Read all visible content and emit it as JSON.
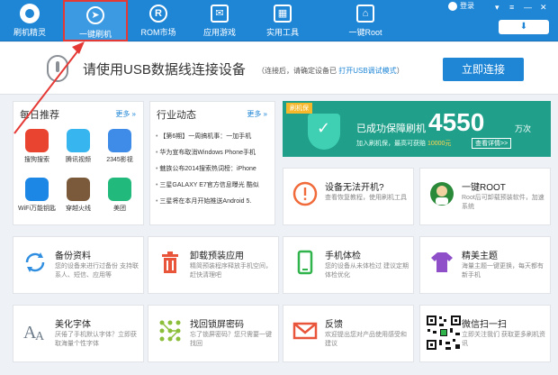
{
  "app": {
    "logo_label": "刷机精灵",
    "user_label": "登录"
  },
  "nav": {
    "tabs": [
      {
        "label": "一键刷机",
        "icon": "cursor-icon"
      },
      {
        "label": "ROM市场",
        "icon": "rom-icon"
      },
      {
        "label": "应用游戏",
        "icon": "mail-icon"
      },
      {
        "label": "实用工具",
        "icon": "tools-grid-icon"
      },
      {
        "label": "一键Root",
        "icon": "root-icon"
      }
    ]
  },
  "connect": {
    "main_text": "请使用USB数据线连接设备",
    "sub_text": "（连接后，请确定设备已 ",
    "sub_link": "打开USB调试模式",
    "sub_end": "）",
    "button_label": "立即连接"
  },
  "recommend": {
    "title": "每日推荐",
    "more": "更多",
    "apps": [
      {
        "label": "搜狗搜索",
        "color": "#e8442f"
      },
      {
        "label": "腾讯视频",
        "color": "#36b5ef"
      },
      {
        "label": "2345影视",
        "color": "#3e8be8"
      },
      {
        "label": "WiFi万能钥匙",
        "color": "#1d87e5"
      },
      {
        "label": "穿越火线",
        "color": "#7a5a3a"
      },
      {
        "label": "美团",
        "color": "#22b97c"
      }
    ]
  },
  "news": {
    "title": "行业动态",
    "more": "更多",
    "items": [
      "【第6期】一周搞机事：一加手机",
      "华为宣布取消Windows Phone手机",
      "魅族公布2014搜索热词榜：iPhone",
      "三星GALAXY E7官方信息曝光 酷似",
      "三星将在本月开始推送Android 5."
    ]
  },
  "banner": {
    "tag": "刷机保",
    "label": "已成功保障刷机",
    "count": "4550",
    "unit": "万次",
    "sub_a": "加入刷机保，最高可获赔 ",
    "sub_amount": "10000元",
    "link": "查看详情>>"
  },
  "features": [
    {
      "title": "设备无法开机?",
      "desc": "查看恢复教程，使用刷机工具",
      "icon": "alert-icon"
    },
    {
      "title": "一键ROOT",
      "desc": "Root后可卸载预装软件，加速系统",
      "icon": "root-avatar-icon"
    },
    {
      "title": "备份资料",
      "desc": "您的设备来进行过备份 支持联系人、短信、应用等",
      "icon": "sync-icon"
    },
    {
      "title": "卸载预装应用",
      "desc": "精简预装程序释放手机空间，赶快清理吧",
      "icon": "trash-icon"
    },
    {
      "title": "手机体检",
      "desc": "您的设备从未体检过 建议定期体检优化",
      "icon": "phone-check-icon"
    },
    {
      "title": "精美主题",
      "desc": "海量主题一键更换，每天都有新手机",
      "icon": "shirt-icon"
    },
    {
      "title": "美化字体",
      "desc": "厌倦了手机默认字体？立即获取海量个性字体",
      "icon": "font-icon"
    },
    {
      "title": "找回锁屏密码",
      "desc": "忘了锁屏密码？您只需要一键找回",
      "icon": "pattern-lock-icon"
    },
    {
      "title": "反馈",
      "desc": "欢迎提出您对产品使用感受和建议",
      "icon": "envelope-icon"
    },
    {
      "title": "微信扫一扫",
      "desc": "立即关注我们 获取更多刷机资讯",
      "icon": "qr-code-icon"
    }
  ],
  "colors": {
    "primary": "#1f86d6",
    "banner": "#20a08a",
    "highlight": "#e53935"
  }
}
